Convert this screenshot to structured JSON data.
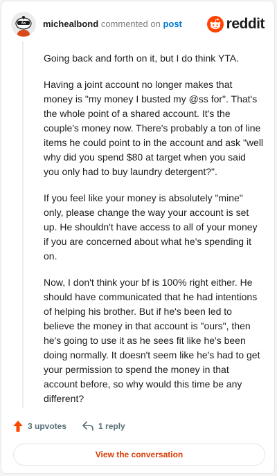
{
  "header": {
    "username": "michealbond",
    "action_text": "commented on",
    "post_link": "post",
    "brand": "reddit"
  },
  "comment": {
    "paragraphs": [
      "Going back and forth on it, but I do think YTA.",
      "Having a joint account no longer makes that money is \"my money I busted my @ss for\". That's the whole point of a shared account. It's the couple's money now. There's probably a ton of line items he could point to in the account and ask \"well why did you spend $80 at target when you said you only had to buy laundry detergent?\".",
      "If you feel like your money is absolutely \"mine\" only, please change the way your account is set up. He shouldn't have access to all of your money if you are concerned about what he's spending it on.",
      "Now, I don't think your bf is 100% right either. He should have communicated that he had intentions of helping his brother. But if he's been led to believe the money in that account is \"ours\", then he's going to use it as he sees fit like he's been doing normally. It doesn't seem like he's had to get your permission to spend the money in that account before, so why would this time be any different?"
    ]
  },
  "actions": {
    "upvotes": "3 upvotes",
    "replies": "1 reply"
  },
  "footer": {
    "view_button": "View the conversation"
  },
  "icons": {
    "upvote": "upvote-arrow-icon",
    "reply": "reply-arrow-icon",
    "logo": "reddit-snoo-icon",
    "avatar": "snoo-avatar"
  },
  "colors": {
    "accent": "#ff4500",
    "link": "#0079d3",
    "button_text": "#d93a00"
  }
}
